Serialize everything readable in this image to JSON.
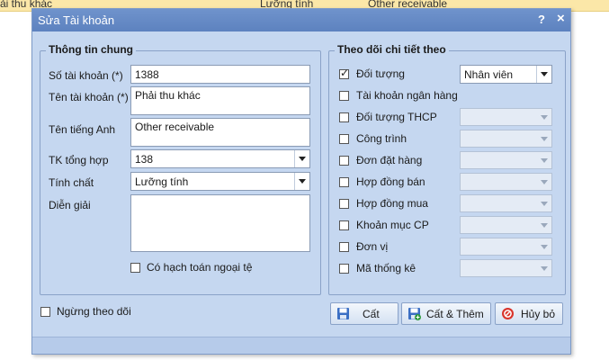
{
  "background_row": {
    "col1": "ải thu khác",
    "col2": "Lưỡng tính",
    "col3": "Other receivable"
  },
  "dialog": {
    "title": "Sửa Tài khoản",
    "help": "?",
    "close": "×"
  },
  "general": {
    "title": "Thông tin chung",
    "account_no_label": "Số tài khoản (*)",
    "account_no_value": "1388",
    "account_name_label": "Tên tài khoản (*)",
    "account_name_value": "Phải thu khác",
    "english_name_label": "Tên tiếng Anh",
    "english_name_value": "Other receivable",
    "parent_label": "TK tổng hợp",
    "parent_value": "138",
    "nature_label": "Tính chất",
    "nature_value": "Lưỡng tính",
    "description_label": "Diễn giải",
    "description_value": "",
    "foreign_currency_label": "Có hạch toán ngoại tệ"
  },
  "tracking": {
    "title": "Theo dõi chi tiết theo",
    "items": [
      {
        "label": "Đối tượng",
        "checked": true,
        "value": "Nhân viên"
      },
      {
        "label": "Tài khoản ngân hàng",
        "checked": false
      },
      {
        "label": "Đối tượng THCP",
        "checked": false,
        "value": ""
      },
      {
        "label": "Công trình",
        "checked": false,
        "value": ""
      },
      {
        "label": "Đơn đặt hàng",
        "checked": false,
        "value": ""
      },
      {
        "label": "Hợp đồng bán",
        "checked": false,
        "value": ""
      },
      {
        "label": "Hợp đồng mua",
        "checked": false,
        "value": ""
      },
      {
        "label": "Khoản mục CP",
        "checked": false,
        "value": ""
      },
      {
        "label": "Đơn vị",
        "checked": false,
        "value": ""
      },
      {
        "label": "Mã thống kê",
        "checked": false,
        "value": ""
      }
    ]
  },
  "footer": {
    "stop_tracking_label": "Ngừng theo dõi",
    "save_label": "Cất",
    "save_new_label": "Cất & Thêm",
    "cancel_label": "Hủy bỏ"
  }
}
